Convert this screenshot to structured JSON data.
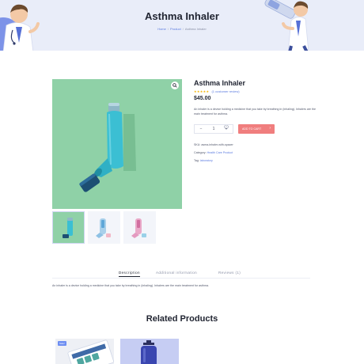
{
  "banner": {
    "title": "Asthma Inhaler",
    "breadcrumb": [
      "Home",
      "Product",
      "Asthma Inhaler"
    ],
    "separator": "/"
  },
  "product": {
    "title": "Asthma Inhaler",
    "rating_stars": "★★★★★",
    "rating_value": 5,
    "reviews_link": "(1 customer review)",
    "price": "$45.00",
    "description": "An inhaler is a device holding a medicine that you take by breathing in (inhaling). Inhalers are the main treatment for asthma.",
    "quantity": "1",
    "qty_minus": "−",
    "qty_plus": "+",
    "wishlist_icon": "heart-icon",
    "add_to_cart": "ADD TO CART",
    "sku_label": "SKU:",
    "sku": "asma-inhaler-with-spacer",
    "category_label": "Category:",
    "category": "Health Care Product",
    "tag_label": "Tag:",
    "tag": "laboratory"
  },
  "gallery": {
    "zoom_icon": "magnifier-icon",
    "thumbs": [
      "inhaler-green",
      "inhaler-blue",
      "inhaler-pink"
    ]
  },
  "tabs": {
    "items": [
      "Description",
      "Additional information",
      "Reviews (1)"
    ],
    "active": "Description",
    "content": "An inhaler is a device holding a medicine that you take by breathing in (inhaling). Inhalers are the main treatment for asthma."
  },
  "related": {
    "title": "Related Products",
    "badge": "Sale!"
  },
  "colors": {
    "banner_bg": "#e9edf9",
    "accent_blue": "#5b7be0",
    "cart_button": "#f07e7e",
    "star": "#f5b400",
    "inhaler_teal": "#3bbfd3",
    "image_green": "#8fd1a7"
  }
}
